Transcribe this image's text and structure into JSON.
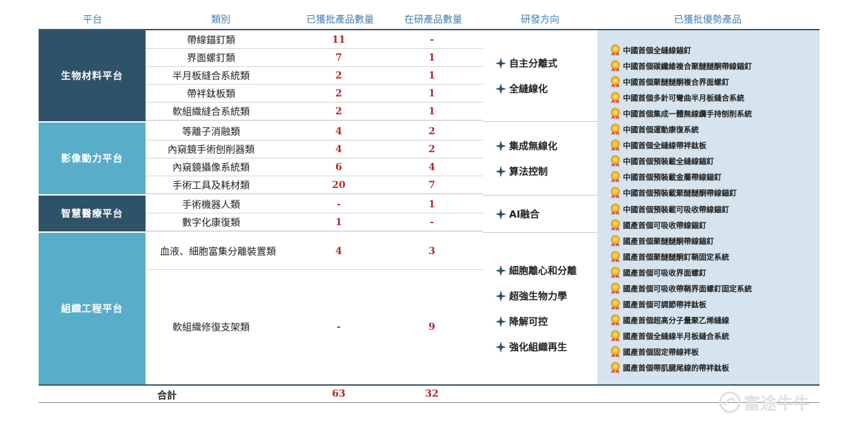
{
  "headers": {
    "platform": "平台",
    "category": "類別",
    "approved": "已獲批產品數量",
    "rnd": "在研產品數量",
    "direction": "研發方向",
    "products": "已獲批優勢產品"
  },
  "platforms": [
    {
      "name": "生物材料平台",
      "rows": [
        {
          "category": "帶線錨釘類",
          "approved": "11",
          "rnd": "-"
        },
        {
          "category": "界面螺釘類",
          "approved": "7",
          "rnd": "1"
        },
        {
          "category": "半月板縫合系統類",
          "approved": "2",
          "rnd": "1"
        },
        {
          "category": "帶袢鈦板類",
          "approved": "2",
          "rnd": "1"
        },
        {
          "category": "軟組織縫合系統類",
          "approved": "2",
          "rnd": "1"
        }
      ],
      "directions": [
        "自主分離式",
        "全縫線化"
      ]
    },
    {
      "name": "影像動力平台",
      "rows": [
        {
          "category": "等離子消融類",
          "approved": "4",
          "rnd": "2"
        },
        {
          "category": "內窺鏡手術刨削器類",
          "approved": "4",
          "rnd": "2"
        },
        {
          "category": "內窺鏡攝像系統類",
          "approved": "6",
          "rnd": "4"
        },
        {
          "category": "手術工具及耗材類",
          "approved": "20",
          "rnd": "7"
        }
      ],
      "directions": [
        "集成無線化",
        "算法控制"
      ]
    },
    {
      "name": "智慧醫療平台",
      "rows": [
        {
          "category": "手術機器人類",
          "approved": "-",
          "rnd": "1"
        },
        {
          "category": "數字化康復類",
          "approved": "1",
          "rnd": "-"
        }
      ],
      "directions": [
        "AI融合"
      ]
    },
    {
      "name": "組織工程平台",
      "rows": [
        {
          "category": "血液、細胞富集分離裝置類",
          "approved": "4",
          "rnd": "3"
        },
        {
          "category": "軟組織修復支架類",
          "approved": "-",
          "rnd": "9"
        }
      ],
      "directions": [
        "細胞離心和分離",
        "超強生物力學",
        "降解可控",
        "強化組織再生"
      ]
    }
  ],
  "products": [
    "中國首個全縫線錨釘",
    "中國首個碳纖維複合聚醚醚酮帶線錨釘",
    "中國首個聚醚醚酮複合界面螺釘",
    "中國首個多針可彎曲半月板縫合系統",
    "中國首個集成一體無線纜手持刨削系統",
    "中國首個運動康復系統",
    "中國首個全縫線帶袢鈦板",
    "中國首個預裝載全縫線錨釘",
    "中國首個預裝載金屬帶線錨釘",
    "中國首個預裝載聚醚醚酮帶線錨釘",
    "中國首個預裝載可吸收帶線錨釘",
    "國產首個可吸收帶線錨釘",
    "國產首個聚醚醚酮帶線錨釘",
    "國產首個聚醚醚酮釘鞘固定系統",
    "國產首個可吸收界面螺釘",
    "國產首個可吸收帶鞘界面螺釘固定系統",
    "國產首個可調節帶袢鈦板",
    "國產首個超高分子量聚乙烯縫線",
    "國產首個全縫線半月板縫合系統",
    "國產首個固定帶線袢板",
    "國產首個帶肌腱尾線的帶袢鈦板"
  ],
  "total": {
    "label": "合計",
    "approved": "63",
    "rnd": "32"
  },
  "watermark": "富途牛牛",
  "icons": {
    "direction": "four-point-star-icon",
    "product": "medal-icon"
  },
  "colors": {
    "dark_platform": "#2e5268",
    "light_platform": "#58aec9",
    "number": "#b3282c",
    "header": "#3f7fb5",
    "panel": "#d5e4ef"
  }
}
